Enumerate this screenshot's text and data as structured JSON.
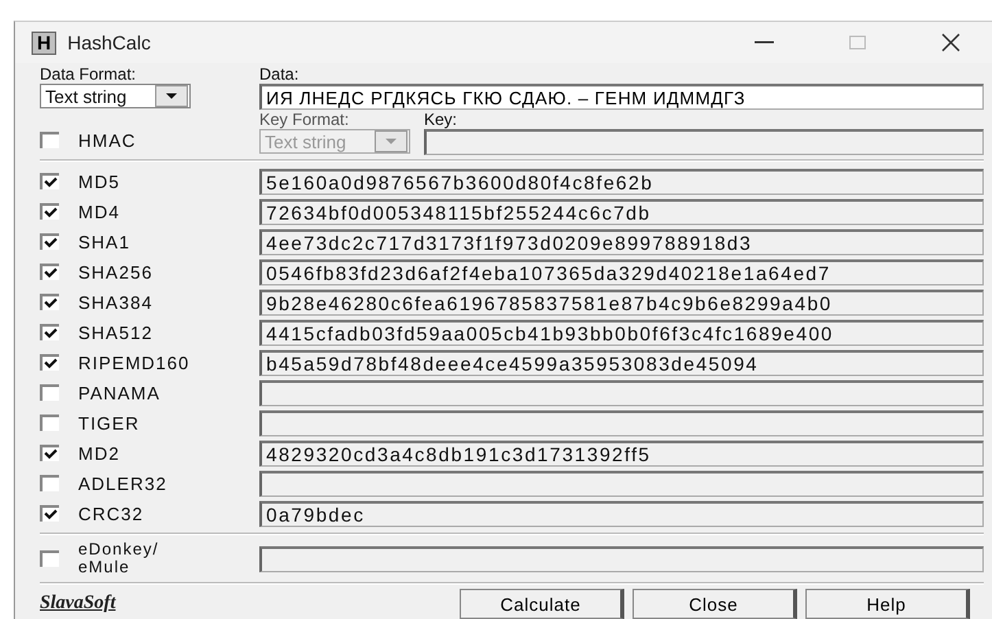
{
  "window": {
    "title": "HashCalc",
    "icon_letter": "H"
  },
  "data_format": {
    "label": "Data Format:",
    "value": "Text string"
  },
  "data": {
    "label": "Data:",
    "value": "ИЯ ЛНЕДС РГДКЯСЬ ГКЮ СДАЮ. – ГЕНМ ИДММДГЗ"
  },
  "hmac": {
    "label": "HMAC",
    "checked": false
  },
  "key_format": {
    "label": "Key Format:",
    "value": "Text string",
    "disabled": true
  },
  "key": {
    "label": "Key:"
  },
  "algorithms": [
    {
      "name": "MD5",
      "checked": true,
      "value": "5e160a0d9876567b3600d80f4c8fe62b"
    },
    {
      "name": "MD4",
      "checked": true,
      "value": "72634bf0d005348115bf255244c6c7db"
    },
    {
      "name": "SHA1",
      "checked": true,
      "value": "4ee73dc2c717d3173f1f973d0209e899788918d3"
    },
    {
      "name": "SHA256",
      "checked": true,
      "value": "0546fb83fd23d6af2f4eba107365da329d40218e1a64ed7"
    },
    {
      "name": "SHA384",
      "checked": true,
      "value": "9b28e46280c6fea6196785837581e87b4c9b6e8299a4b0"
    },
    {
      "name": "SHA512",
      "checked": true,
      "value": "4415cfadb03fd59aa005cb41b93bb0b0f6f3c4fc1689e400"
    },
    {
      "name": "RIPEMD160",
      "checked": true,
      "value": "b45a59d78bf48deee4ce4599a35953083de45094"
    },
    {
      "name": "PANAMA",
      "checked": false
    },
    {
      "name": "TIGER",
      "checked": false
    },
    {
      "name": "MD2",
      "checked": true,
      "value": "4829320cd3a4c8db191c3d1731392ff5"
    },
    {
      "name": "ADLER32",
      "checked": false
    },
    {
      "name": "CRC32",
      "checked": true,
      "value": "0a79bdec"
    }
  ],
  "edonkey": {
    "name": "eDonkey/ eMule",
    "checked": false
  },
  "logo": "SlavaSoft",
  "buttons": [
    "Calculate",
    "Close",
    "Help"
  ]
}
